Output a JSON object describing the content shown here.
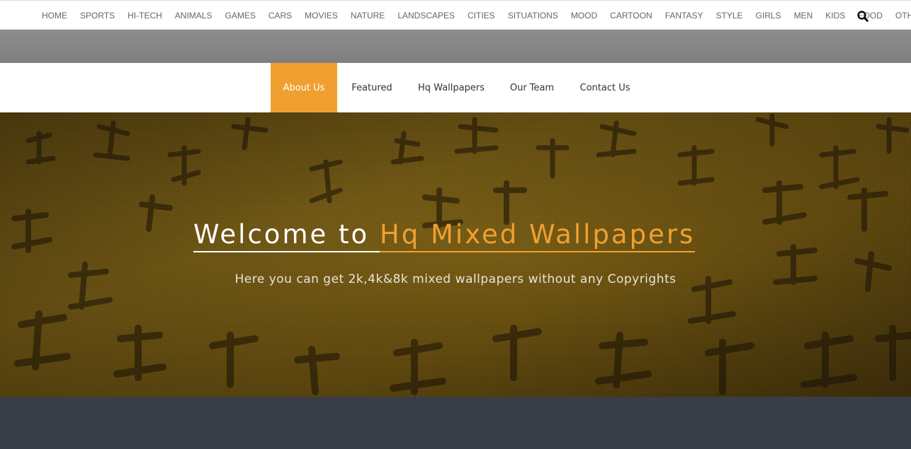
{
  "top_nav": {
    "items": [
      "HOME",
      "SPORTS",
      "HI-TECH",
      "ANIMALS",
      "GAMES",
      "CARS",
      "MOVIES",
      "NATURE",
      "LANDSCAPES",
      "CITIES",
      "SITUATIONS",
      "MOOD",
      "CARTOON",
      "FANTASY",
      "STYLE",
      "GIRLS",
      "MEN",
      "KIDS",
      "FOOD",
      "OTHER"
    ],
    "search_icon": "search-icon"
  },
  "sub_nav": {
    "items": [
      "About Us",
      "Featured",
      "Hq Wallpapers",
      "Our Team",
      "Contact Us"
    ],
    "active": "About Us"
  },
  "hero": {
    "title_prefix": "Welcome to ",
    "title_highlight": "Hq Mixed Wallpapers",
    "subtitle": "Here you can get 2k,4k&8k mixed wallpapers without any Copyrights"
  },
  "colors": {
    "accent": "#f0a030",
    "dark_band": "#383e45",
    "grey_strip": "#858585"
  }
}
